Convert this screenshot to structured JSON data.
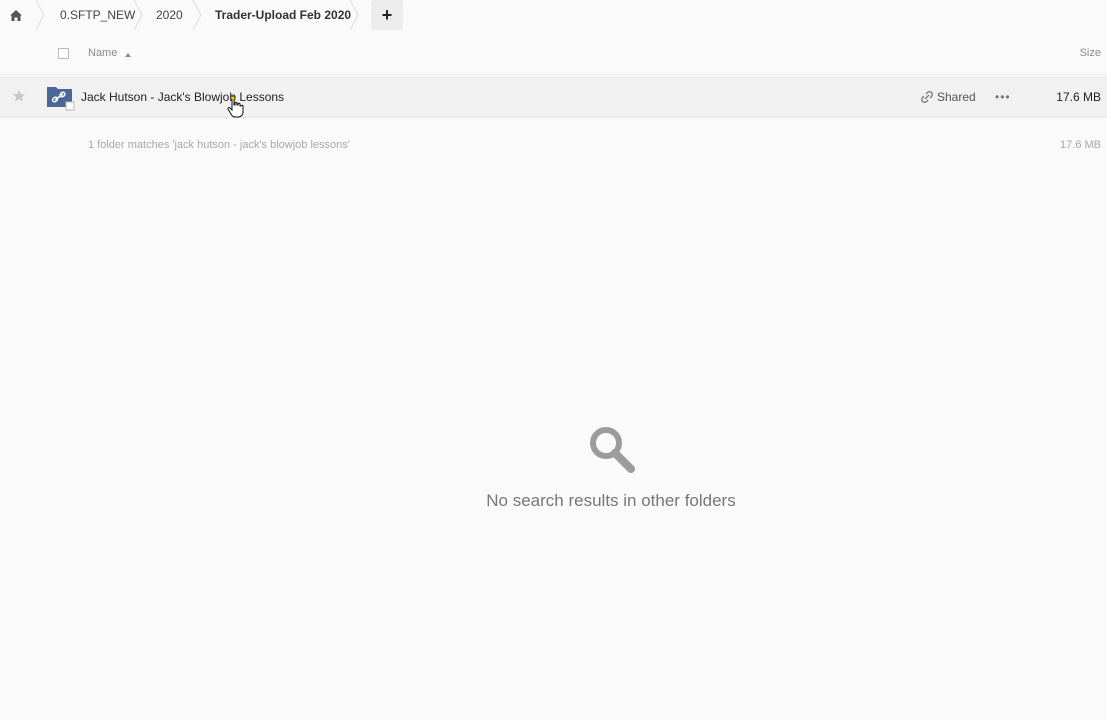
{
  "breadcrumb": {
    "items": [
      {
        "label": "0.SFTP_NEW"
      },
      {
        "label": "2020"
      },
      {
        "label": "Trader-Upload Feb 2020"
      }
    ],
    "add_label": "+"
  },
  "table": {
    "columns": {
      "name": "Name",
      "size": "Size"
    },
    "rows": [
      {
        "name": "Jack Hutson - Jack's Blowjob Lessons",
        "shared_label": "Shared",
        "more_label": "•••",
        "size": "17.6 MB"
      }
    ],
    "summary": {
      "text": "1 folder matches 'jack hutson - jack's blowjob lessons'",
      "size": "17.6 MB"
    }
  },
  "empty_state": {
    "message": "No search results in other folders",
    "icon": "search-icon"
  },
  "colors": {
    "folder_blue": "#4b6795",
    "accent_gray": "#777777"
  }
}
